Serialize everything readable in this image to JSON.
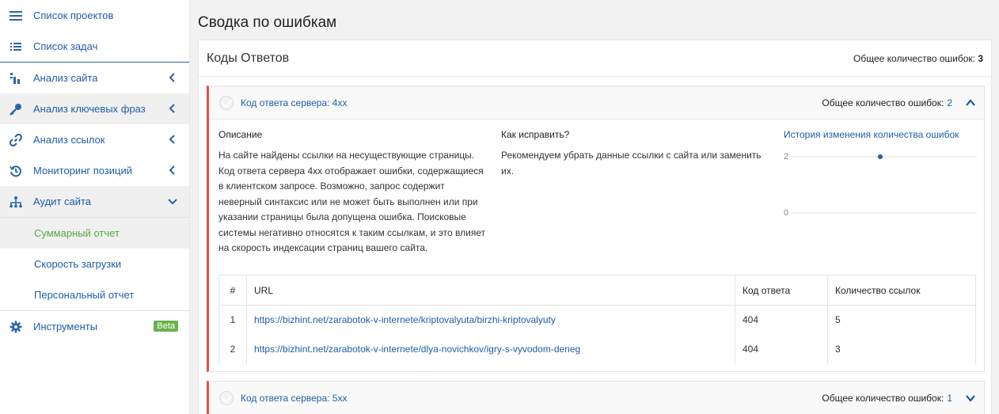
{
  "sidebar": {
    "items": [
      {
        "label": "Список проектов",
        "icon": "menu-icon"
      },
      {
        "label": "Список задач",
        "icon": "list-icon"
      },
      {
        "label": "Анализ сайта",
        "icon": "site-analysis-icon"
      },
      {
        "label": "Анализ ключевых фраз",
        "icon": "key-icon"
      },
      {
        "label": "Анализ ссылок",
        "icon": "link-icon"
      },
      {
        "label": "Мониторинг позиций",
        "icon": "history-icon"
      },
      {
        "label": "Аудит сайта",
        "icon": "sitemap-icon"
      }
    ],
    "subitems": [
      "Суммарный отчет",
      "Скорость загрузки",
      "Персональный отчет"
    ],
    "tools": {
      "label": "Инструменты",
      "badge": "Beta",
      "icon": "gear-icon"
    }
  },
  "page": {
    "title": "Сводка по ошибкам"
  },
  "card": {
    "title": "Коды Ответов",
    "total_label": "Общее количество ошибок:",
    "total_value": "3"
  },
  "panel_4xx": {
    "title": "Код ответа сервера: 4xx",
    "total_label": "Общее количество ошибок:",
    "total_value": "2",
    "description_heading": "Описание",
    "description": "На сайте найдены ссылки на несуществующие страницы. Код ответа сервера 4xx отображает ошибки, содержащиеся в клиентском запросе. Возможно, запрос содержит неверный синтаксис или не может быть выполнен или при указании страницы была допущена ошибка. Поисковые системы негативно относятся к таким ссылкам, и это влияет на скорость индексации страниц вашего сайта.",
    "fix_heading": "Как исправить?",
    "fix": "Рекомендуем убрать данные ссылки с сайта или заменить их.",
    "history_title": "История изменения количества ошибок",
    "history_y_ticks": [
      "2",
      "0"
    ],
    "history_point": 2,
    "table": {
      "headers": [
        "#",
        "URL",
        "Код ответа",
        "Количество ссылок"
      ],
      "rows": [
        {
          "n": "1",
          "url": "https://bizhint.net/zarabotok-v-internete/kriptovalyuta/birzhi-kriptovalyuty",
          "code": "404",
          "count": "5"
        },
        {
          "n": "2",
          "url": "https://bizhint.net/zarabotok-v-internete/dlya-novichkov/igry-s-vyvodom-deneg",
          "code": "404",
          "count": "3"
        }
      ]
    }
  },
  "panel_5xx": {
    "title": "Код ответа сервера: 5xx",
    "total_label": "Общее количество ошибок:",
    "total_value": "1"
  },
  "colors": {
    "accent_blue": "#1f5ea8",
    "error_red": "#d9534f",
    "active_green": "#5aa641",
    "beta_green": "#6cb14f"
  }
}
